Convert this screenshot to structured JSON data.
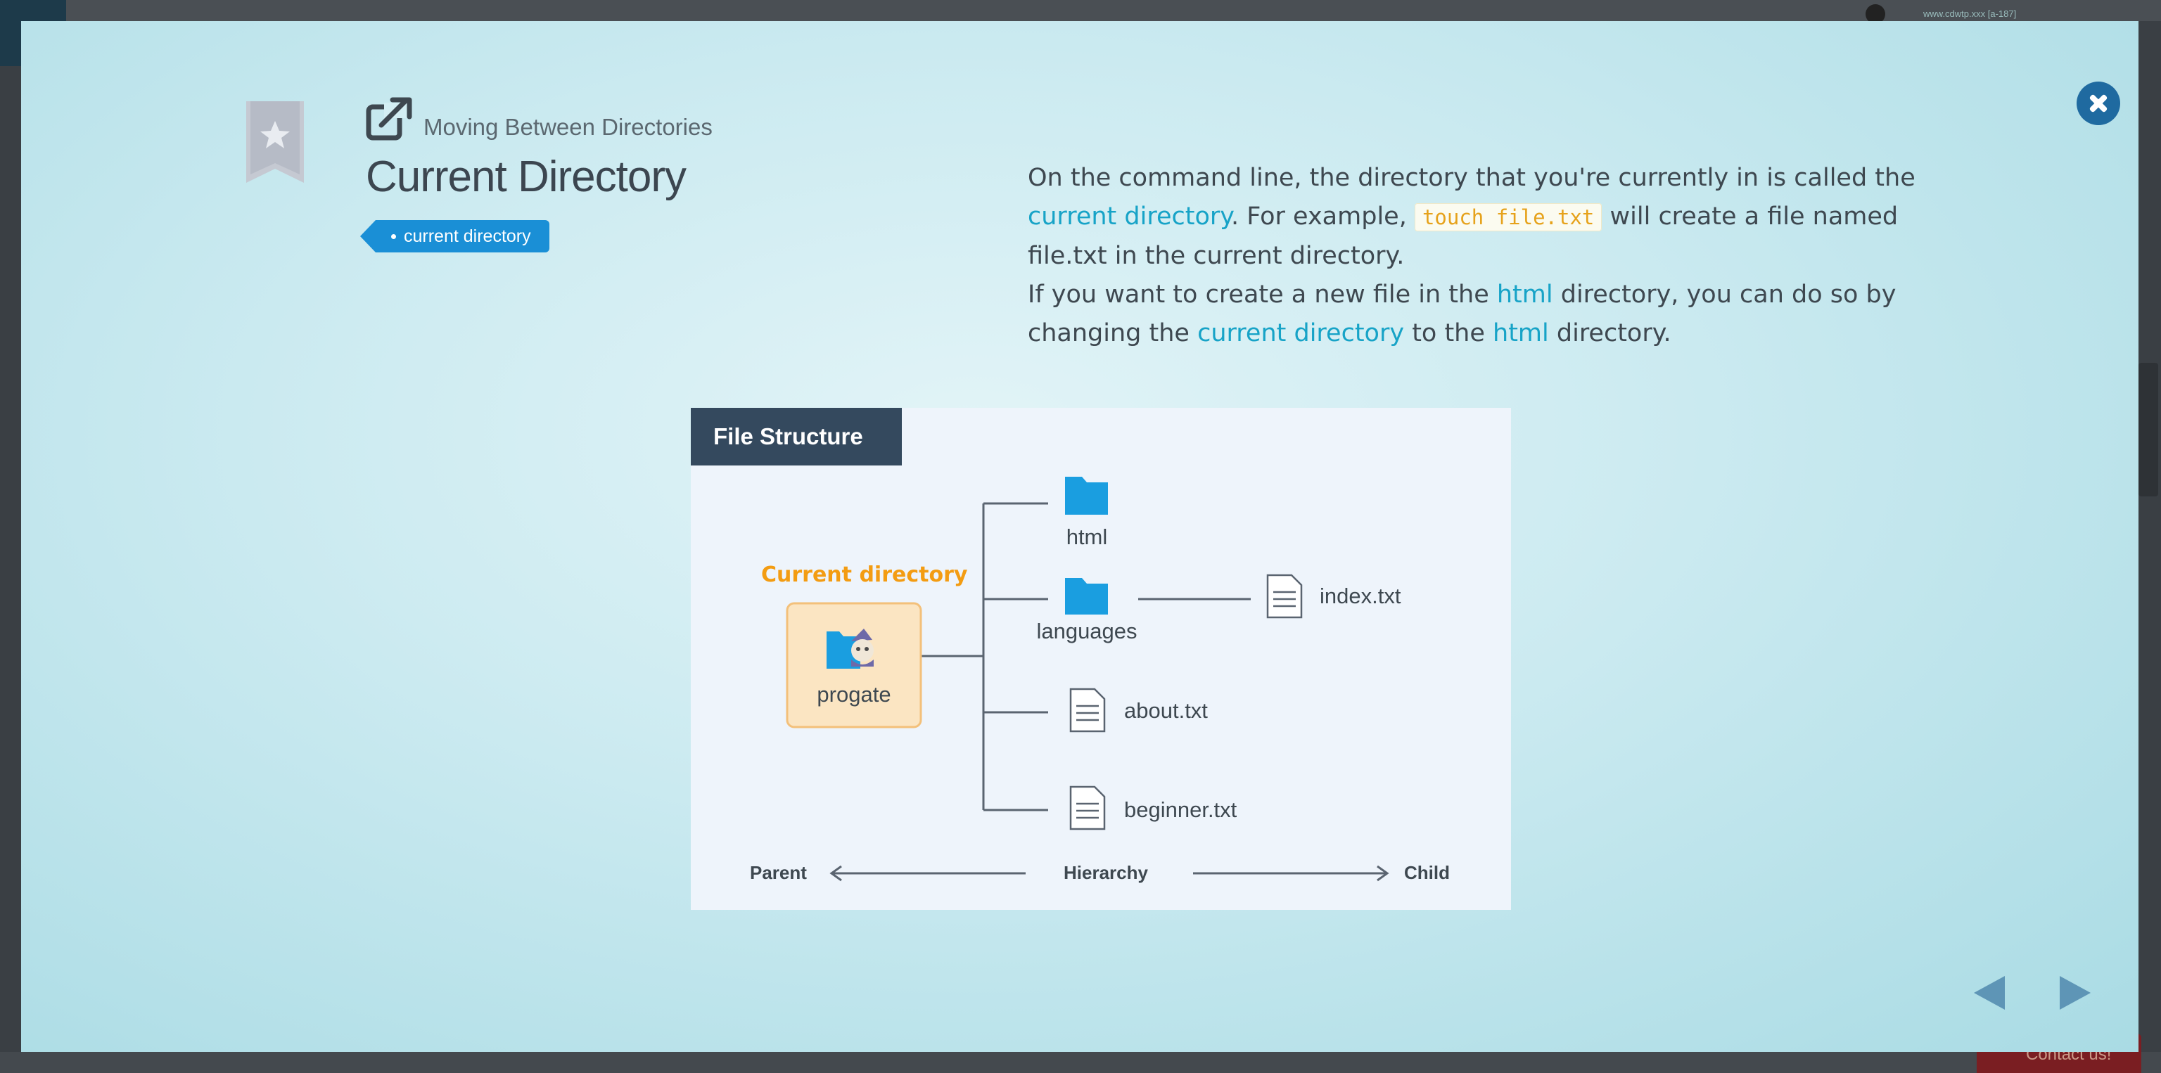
{
  "background": {
    "url_text": "www.cdwtp.xxx [a-187]",
    "contact_label": "Contact us!"
  },
  "modal": {
    "lesson_title": "Moving Between Directories",
    "page_title": "Current Directory",
    "tag_label": "current directory",
    "description": {
      "p1_a": "On the command line, the directory that you're currently in is called the ",
      "p1_link": "current directory",
      "p1_b": ". For example, ",
      "p1_code": "touch file.txt",
      "p1_c": " will create a file named file.txt in the current directory.",
      "p2_a": "If you want to create a new file in the ",
      "p2_link1": "html",
      "p2_b": " directory, you can do so by changing the ",
      "p2_link2": "current directory",
      "p2_c": " to the ",
      "p2_link3": "html",
      "p2_d": " directory."
    },
    "diagram": {
      "title": "File Structure",
      "current_label": "Current directory",
      "current_folder": "progate",
      "items": {
        "html": "html",
        "languages": "languages",
        "index": "index.txt",
        "about": "about.txt",
        "beginner": "beginner.txt"
      },
      "axis": {
        "parent": "Parent",
        "hierarchy": "Hierarchy",
        "child": "Child"
      }
    },
    "colors": {
      "accent": "#17a3c7",
      "tag_bg": "#1a8fd6",
      "code_text": "#e6a21b",
      "folder": "#1a9ee0",
      "highlight_orange": "#f39c12",
      "close_bg": "#1f6aa0",
      "nav_arrow": "#5e95b6"
    }
  }
}
